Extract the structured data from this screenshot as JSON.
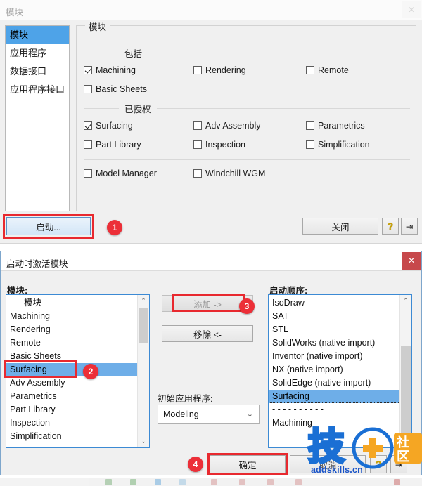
{
  "outer_window": {
    "title": "模块",
    "close_icon": "close-icon",
    "close_glyph": "✕"
  },
  "dialog_modules": {
    "sidebar": {
      "items": [
        {
          "label": "模块",
          "selected": true
        },
        {
          "label": "应用程序",
          "selected": false
        },
        {
          "label": "数据接口",
          "selected": false
        },
        {
          "label": "应用程序接口",
          "selected": false
        }
      ]
    },
    "groupbox_title": "模块",
    "sections": [
      {
        "label": "包括",
        "checkboxes": [
          {
            "label": "Machining",
            "checked": true,
            "col": 0,
            "row": 0
          },
          {
            "label": "Rendering",
            "checked": false,
            "col": 1,
            "row": 0
          },
          {
            "label": "Remote",
            "checked": false,
            "col": 2,
            "row": 0
          },
          {
            "label": "Basic Sheets",
            "checked": false,
            "col": 0,
            "row": 1
          }
        ]
      },
      {
        "label": "已授权",
        "checkboxes": [
          {
            "label": "Surfacing",
            "checked": true,
            "col": 0,
            "row": 0
          },
          {
            "label": "Adv Assembly",
            "checked": false,
            "col": 1,
            "row": 0
          },
          {
            "label": "Parametrics",
            "checked": false,
            "col": 2,
            "row": 0
          },
          {
            "label": "Part Library",
            "checked": false,
            "col": 0,
            "row": 1
          },
          {
            "label": "Inspection",
            "checked": false,
            "col": 1,
            "row": 1
          },
          {
            "label": "Simplification",
            "checked": false,
            "col": 2,
            "row": 1
          }
        ]
      },
      {
        "label": "",
        "checkboxes": [
          {
            "label": "Model Manager",
            "checked": false,
            "col": 0,
            "row": 0
          },
          {
            "label": "Windchill WGM",
            "checked": false,
            "col": 1,
            "row": 0
          }
        ]
      }
    ],
    "buttons": {
      "start": "启动...",
      "close": "关闭",
      "help_icon": "help-question-icon",
      "help_glyph": "?",
      "pin_icon": "pin-icon",
      "pin_glyph": "⇥"
    }
  },
  "dialog_startup": {
    "title": "启动时激活模块",
    "close_icon": "close-icon",
    "close_glyph": "✕",
    "labels": {
      "modules": "模块:",
      "startup_order": "启动顺序:",
      "initial_app": "初始应用程序:"
    },
    "modules_list": [
      {
        "label": "---- 模块 ----",
        "selected": false
      },
      {
        "label": "Machining",
        "selected": false
      },
      {
        "label": "Rendering",
        "selected": false
      },
      {
        "label": "Remote",
        "selected": false
      },
      {
        "label": "Basic Sheets",
        "selected": false
      },
      {
        "label": "Surfacing",
        "selected": true
      },
      {
        "label": "Adv Assembly",
        "selected": false
      },
      {
        "label": "Parametrics",
        "selected": false
      },
      {
        "label": "Part Library",
        "selected": false
      },
      {
        "label": "Inspection",
        "selected": false
      },
      {
        "label": "Simplification",
        "selected": false
      }
    ],
    "startup_order_list": [
      {
        "label": "IsoDraw",
        "selected": false
      },
      {
        "label": "SAT",
        "selected": false
      },
      {
        "label": "STL",
        "selected": false
      },
      {
        "label": "SolidWorks (native import)",
        "selected": false
      },
      {
        "label": "Inventor (native import)",
        "selected": false
      },
      {
        "label": "NX (native import)",
        "selected": false
      },
      {
        "label": "SolidEdge (native import)",
        "selected": false
      },
      {
        "label": "Surfacing",
        "selected": true
      },
      {
        "label": "- - - - - - - - - -",
        "selected": false
      },
      {
        "label": "Machining",
        "selected": false
      }
    ],
    "buttons": {
      "add": "添加 ->",
      "remove": "移除 <-",
      "ok": "确定",
      "cancel": "取消",
      "help_icon": "help-question-icon",
      "help_glyph": "?",
      "pin_icon": "pin-icon",
      "pin_glyph": "⇥"
    },
    "initial_app_select": {
      "value": "Modeling",
      "chevron_icon": "chevron-down-icon",
      "chevron_glyph": "⌄"
    },
    "scrollbars": {
      "up_glyph": "⌃",
      "down_glyph": "⌄"
    }
  },
  "annotations": {
    "badges": [
      {
        "number": "1"
      },
      {
        "number": "2"
      },
      {
        "number": "3"
      },
      {
        "number": "4"
      }
    ],
    "highlight_color": "#e8292f",
    "badge_color": "#ec2f38"
  },
  "watermark": {
    "logo_char": "技",
    "plus_glyph": "+",
    "community_text": "社区",
    "url": "addskills.cn",
    "blue": "#1a6fd4",
    "orange": "#f5a623"
  }
}
